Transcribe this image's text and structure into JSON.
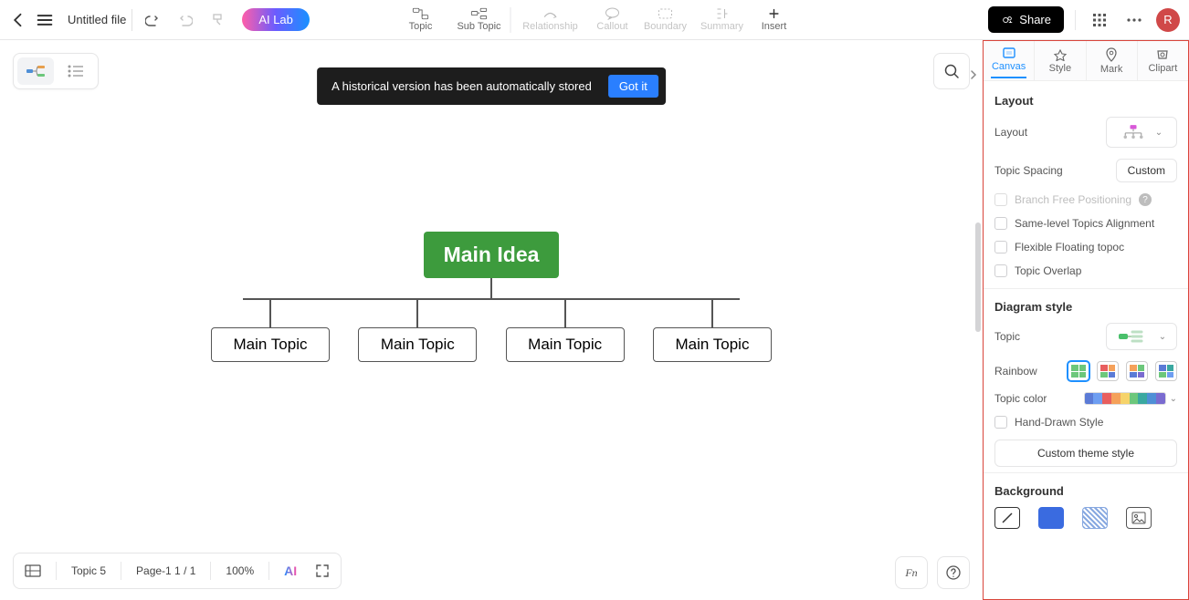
{
  "header": {
    "file_title": "Untitled file",
    "ai_lab": "AI Lab",
    "tools": {
      "topic": "Topic",
      "subtopic": "Sub Topic",
      "relationship": "Relationship",
      "callout": "Callout",
      "boundary": "Boundary",
      "summary": "Summary",
      "insert": "Insert"
    },
    "share": "Share",
    "avatar_initial": "R"
  },
  "toast": {
    "message": "A historical version has been automatically stored",
    "button": "Got it"
  },
  "mindmap": {
    "main_idea": "Main Idea",
    "topics": [
      "Main Topic",
      "Main Topic",
      "Main Topic",
      "Main Topic"
    ]
  },
  "bottom": {
    "topic_count": "Topic 5",
    "page_info": "Page-1  1 / 1",
    "zoom": "100%",
    "ai": "AI",
    "fn": "Fn"
  },
  "panel": {
    "tabs": {
      "canvas": "Canvas",
      "style": "Style",
      "mark": "Mark",
      "clipart": "Clipart"
    },
    "layout": {
      "title": "Layout",
      "layout_label": "Layout",
      "spacing_label": "Topic Spacing",
      "spacing_value": "Custom",
      "branch_free": "Branch Free Positioning",
      "same_level": "Same-level Topics Alignment",
      "flexible": "Flexible Floating topoc",
      "overlap": "Topic Overlap"
    },
    "diagram": {
      "title": "Diagram style",
      "topic_label": "Topic",
      "rainbow_label": "Rainbow",
      "topic_color_label": "Topic color",
      "hand_drawn": "Hand-Drawn Style",
      "custom_theme": "Custom theme style"
    },
    "background": {
      "title": "Background"
    },
    "topic_colors": [
      "#5b7bd6",
      "#6e9ef1",
      "#e85e5e",
      "#f5a15a",
      "#f6d36a",
      "#6cc77b",
      "#3aa8a0",
      "#4f8fd6",
      "#7a6bd0"
    ]
  }
}
